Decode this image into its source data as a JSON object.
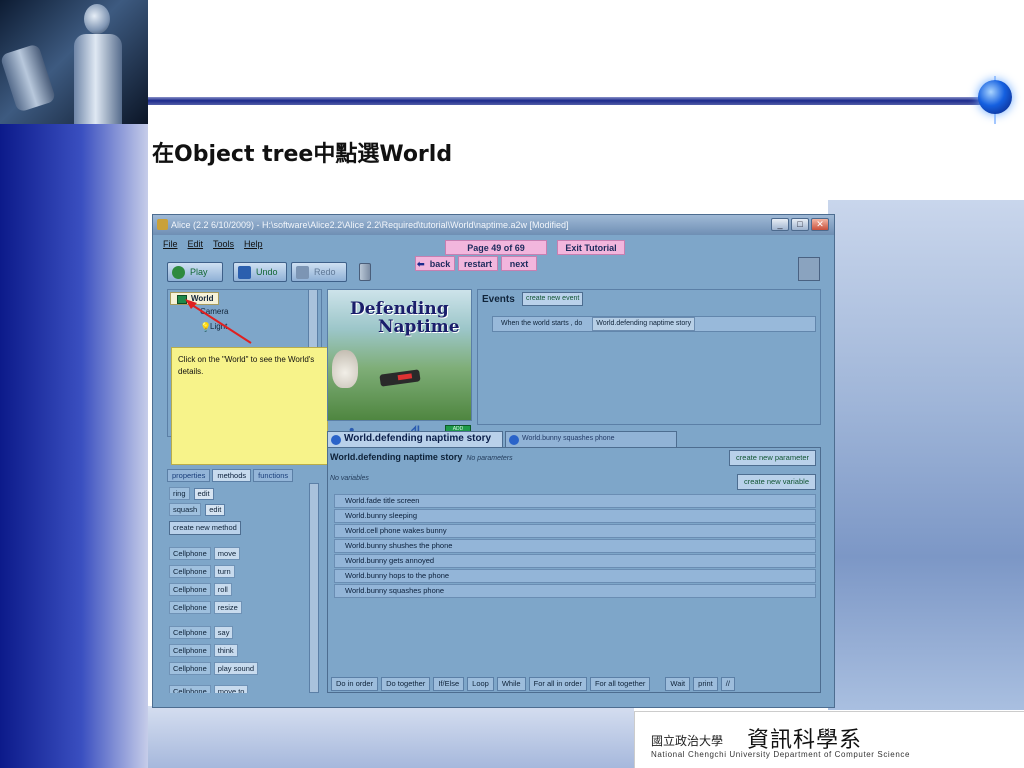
{
  "slide": {
    "title": "在Object tree中點選World"
  },
  "logo": {
    "name_small": "國立政治大學",
    "name_big": "資訊科學系",
    "english": "National Chengchi University Department of Computer Science"
  },
  "window": {
    "title": "Alice (2.2 6/10/2009) - H:\\software\\Alice2.2\\Alice 2.2\\Required\\tutorial\\World\\naptime.a2w [Modified]",
    "minimize": "_",
    "maximize": "□",
    "close": "✕"
  },
  "menu": [
    "File",
    "Edit",
    "Tools",
    "Help"
  ],
  "tutorial": {
    "page": "Page 49 of 69",
    "exit": "Exit Tutorial",
    "back": "back",
    "restart": "restart",
    "next": "next"
  },
  "toolbar": {
    "play": "Play",
    "undo": "Undo",
    "redo": "Redo"
  },
  "object_tree": {
    "world": "World",
    "camera": "Camera",
    "light": "Light"
  },
  "tooltip": "Click on the \"World\" to see the World's details.",
  "scene": {
    "title_line1": "Defending",
    "title_line2": "Naptime",
    "add_objects": "ADD OBJECTS"
  },
  "events": {
    "label": "Events",
    "create": "create new event",
    "when": "When the world starts , do",
    "handler": "World.defending naptime story"
  },
  "details_tabs": [
    "properties",
    "methods",
    "functions"
  ],
  "methods": {
    "ring": "ring",
    "squash": "squash",
    "edit": "edit",
    "create": "create new method",
    "items": [
      {
        "obj": "Cellphone",
        "m": "move"
      },
      {
        "obj": "Cellphone",
        "m": "turn"
      },
      {
        "obj": "Cellphone",
        "m": "roll"
      },
      {
        "obj": "Cellphone",
        "m": "resize"
      },
      {
        "obj": "Cellphone",
        "m": "say"
      },
      {
        "obj": "Cellphone",
        "m": "think"
      },
      {
        "obj": "Cellphone",
        "m": "play sound"
      },
      {
        "obj": "Cellphone",
        "m": "move to"
      }
    ]
  },
  "editor": {
    "tab_active": "World.defending naptime story",
    "tab_other": "World.bunny squashes phone",
    "method_name": "World.defending naptime story",
    "no_params": "No parameters",
    "no_vars": "No variables",
    "create_param": "create new parameter",
    "create_var": "create new variable",
    "statements": [
      "World.fade title screen",
      "World.bunny sleeping",
      "World.cell phone wakes bunny",
      "World.bunny shushes the phone",
      "World.bunny gets annoyed",
      "World.bunny hops to the phone",
      "World.bunny squashes phone"
    ]
  },
  "controls": [
    "Do in order",
    "Do together",
    "If/Else",
    "Loop",
    "While",
    "For all in order",
    "For all together",
    "Wait",
    "print",
    "//"
  ]
}
